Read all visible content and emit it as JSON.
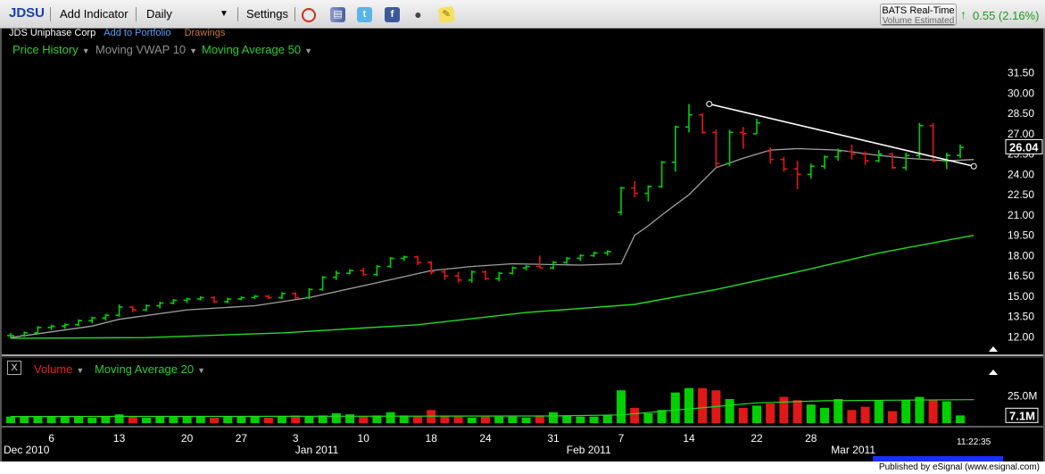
{
  "toolbar": {
    "symbol": "JDSU",
    "add_indicator": "Add Indicator",
    "interval": "Daily",
    "settings": "Settings",
    "icons": [
      "alarm-icon",
      "book-icon",
      "twitter-icon",
      "facebook-icon",
      "camera-icon",
      "note-icon"
    ],
    "twitter_glyph": "t",
    "facebook_glyph": "f",
    "camera_glyph": "●",
    "note_glyph": "✎",
    "alarm_glyph": "⏰",
    "book_glyph": "▤",
    "dropdown_glyph": "▼"
  },
  "quote": {
    "feed": "BATS Real-Time",
    "volume_note": "Volume Estimated",
    "arrow": "↑",
    "change": "0.55 (2.16%)"
  },
  "subheader": {
    "company": "JDS Uniphase Corp",
    "add_portfolio": "Add to Portfolio",
    "drawings": "Drawings"
  },
  "studies": {
    "price_history": "Price History",
    "vwap": "Moving VWAP 10",
    "ma50": "Moving Average 50",
    "dd": "▼"
  },
  "volume_panel": {
    "close_glyph": "X",
    "volume": "Volume",
    "ma20": "Moving Average 20",
    "dd": "▼"
  },
  "time_label": "11:22:35",
  "footer": "Published by eSignal (www.esignal.com)",
  "colors": {
    "up": "#00d000",
    "down": "#e01818",
    "vwap": "#a0a0a0",
    "ma": "#22dd22",
    "trendline": "#ffffff",
    "toolbar_bg": "#dddddd"
  },
  "chart_data": {
    "type": "ohlc",
    "ylim": [
      11.5,
      32.0
    ],
    "y_ticks": [
      12.0,
      13.5,
      15.0,
      16.5,
      18.0,
      19.5,
      21.0,
      22.5,
      24.0,
      25.5,
      27.0,
      28.5,
      30.0,
      31.5
    ],
    "y_tick_labels": [
      "12.00",
      "13.50",
      "15.00",
      "16.50",
      "18.00",
      "19.50",
      "21.00",
      "22.50",
      "24.00",
      "25.50",
      "27.00",
      "28.50",
      "30.00",
      "31.50"
    ],
    "last_price_label": "26.04",
    "last_price": 26.04,
    "x_ticks": [
      {
        "i": 3,
        "label": "6"
      },
      {
        "i": 8,
        "label": "13"
      },
      {
        "i": 13,
        "label": "20"
      },
      {
        "i": 17,
        "label": "27"
      },
      {
        "i": 21,
        "label": "3"
      },
      {
        "i": 26,
        "label": "10"
      },
      {
        "i": 31,
        "label": "18"
      },
      {
        "i": 35,
        "label": "24"
      },
      {
        "i": 40,
        "label": "31"
      },
      {
        "i": 45,
        "label": "7"
      },
      {
        "i": 50,
        "label": "14"
      },
      {
        "i": 55,
        "label": "22"
      },
      {
        "i": 59,
        "label": "28"
      }
    ],
    "month_labels": [
      {
        "i": -0.3,
        "label": "Dec 2010"
      },
      {
        "i": 21.5,
        "label": "Jan 2011"
      },
      {
        "i": 41.5,
        "label": "Feb 2011"
      },
      {
        "i": 61,
        "label": "Mar 2011"
      }
    ],
    "ohlc": [
      [
        12.1,
        12.3,
        11.9,
        12.1
      ],
      [
        12.1,
        12.4,
        12.0,
        12.3
      ],
      [
        12.3,
        12.8,
        12.2,
        12.7
      ],
      [
        12.7,
        12.9,
        12.5,
        12.8
      ],
      [
        12.8,
        13.0,
        12.6,
        12.9
      ],
      [
        12.9,
        13.3,
        12.8,
        13.2
      ],
      [
        13.2,
        13.5,
        13.0,
        13.4
      ],
      [
        13.4,
        13.7,
        13.2,
        13.6
      ],
      [
        13.6,
        14.4,
        13.5,
        14.2
      ],
      [
        14.2,
        14.3,
        13.8,
        14.0
      ],
      [
        14.0,
        14.4,
        13.9,
        14.3
      ],
      [
        14.3,
        14.6,
        14.1,
        14.5
      ],
      [
        14.5,
        14.8,
        14.4,
        14.7
      ],
      [
        14.7,
        14.9,
        14.5,
        14.8
      ],
      [
        14.8,
        15.0,
        14.7,
        14.9
      ],
      [
        14.9,
        15.0,
        14.5,
        14.6
      ],
      [
        14.6,
        14.9,
        14.5,
        14.8
      ],
      [
        14.8,
        15.0,
        14.7,
        14.9
      ],
      [
        14.9,
        15.1,
        14.8,
        15.0
      ],
      [
        15.0,
        15.1,
        14.8,
        14.9
      ],
      [
        14.9,
        15.3,
        14.8,
        15.2
      ],
      [
        15.2,
        15.3,
        14.8,
        14.9
      ],
      [
        14.9,
        15.6,
        14.8,
        15.5
      ],
      [
        15.5,
        16.5,
        15.4,
        16.4
      ],
      [
        16.4,
        16.9,
        16.2,
        16.7
      ],
      [
        16.7,
        17.0,
        16.6,
        16.9
      ],
      [
        16.9,
        17.1,
        16.5,
        16.6
      ],
      [
        16.6,
        17.3,
        16.5,
        17.2
      ],
      [
        17.2,
        17.9,
        17.1,
        17.8
      ],
      [
        17.8,
        18.0,
        17.6,
        17.9
      ],
      [
        17.9,
        18.0,
        17.3,
        17.5
      ],
      [
        17.5,
        17.6,
        16.6,
        16.8
      ],
      [
        16.8,
        17.0,
        16.2,
        16.5
      ],
      [
        16.5,
        16.8,
        16.0,
        16.2
      ],
      [
        16.2,
        16.9,
        16.0,
        16.8
      ],
      [
        16.8,
        16.9,
        16.2,
        16.3
      ],
      [
        16.3,
        16.8,
        16.1,
        16.7
      ],
      [
        16.7,
        17.2,
        16.6,
        17.1
      ],
      [
        17.1,
        17.3,
        16.9,
        17.2
      ],
      [
        17.2,
        18.0,
        17.1,
        17.1
      ],
      [
        17.1,
        17.6,
        17.0,
        17.5
      ],
      [
        17.5,
        17.9,
        17.4,
        17.8
      ],
      [
        17.8,
        18.1,
        17.6,
        18.0
      ],
      [
        18.0,
        18.3,
        17.9,
        18.2
      ],
      [
        18.2,
        18.4,
        18.0,
        18.3
      ],
      [
        21.2,
        23.1,
        21.0,
        23.0
      ],
      [
        23.0,
        23.5,
        22.3,
        22.6
      ],
      [
        22.6,
        23.2,
        22.0,
        23.1
      ],
      [
        23.1,
        25.0,
        23.0,
        24.9
      ],
      [
        24.9,
        27.6,
        24.2,
        27.5
      ],
      [
        27.5,
        29.2,
        27.1,
        28.4
      ],
      [
        28.4,
        28.5,
        27.0,
        27.1
      ],
      [
        27.1,
        27.3,
        24.5,
        24.8
      ],
      [
        24.8,
        27.3,
        24.6,
        27.1
      ],
      [
        27.1,
        27.5,
        25.9,
        27.0
      ],
      [
        27.0,
        28.1,
        27.0,
        27.8
      ],
      [
        25.7,
        26.0,
        24.8,
        25.1
      ],
      [
        25.1,
        25.3,
        24.2,
        24.4
      ],
      [
        24.4,
        25.0,
        22.9,
        24.0
      ],
      [
        24.0,
        24.8,
        23.7,
        24.6
      ],
      [
        24.6,
        25.4,
        24.4,
        25.3
      ],
      [
        25.3,
        25.9,
        25.0,
        25.7
      ],
      [
        25.7,
        26.2,
        25.1,
        25.5
      ],
      [
        25.5,
        25.7,
        24.7,
        25.0
      ],
      [
        25.0,
        25.8,
        24.9,
        25.5
      ],
      [
        25.5,
        25.6,
        24.4,
        24.5
      ],
      [
        24.5,
        25.6,
        24.3,
        25.4
      ],
      [
        25.4,
        27.8,
        25.2,
        27.6
      ],
      [
        27.6,
        27.8,
        24.9,
        25.0
      ],
      [
        25.0,
        25.6,
        24.4,
        25.4
      ],
      [
        25.4,
        26.2,
        25.2,
        26.0
      ]
    ],
    "vwap10": [
      {
        "i": 0,
        "v": 11.95
      },
      {
        "i": 6,
        "v": 12.8
      },
      {
        "i": 8,
        "v": 13.3
      },
      {
        "i": 13,
        "v": 14.0
      },
      {
        "i": 18,
        "v": 14.3
      },
      {
        "i": 22,
        "v": 14.9
      },
      {
        "i": 27,
        "v": 16.0
      },
      {
        "i": 31,
        "v": 16.9
      },
      {
        "i": 34,
        "v": 17.2
      },
      {
        "i": 37,
        "v": 17.4
      },
      {
        "i": 42,
        "v": 17.3
      },
      {
        "i": 45,
        "v": 17.4
      },
      {
        "i": 46,
        "v": 19.5
      },
      {
        "i": 47,
        "v": 20.2
      },
      {
        "i": 48,
        "v": 21.0
      },
      {
        "i": 50,
        "v": 22.5
      },
      {
        "i": 52,
        "v": 24.5
      },
      {
        "i": 54,
        "v": 25.2
      },
      {
        "i": 56,
        "v": 25.8
      },
      {
        "i": 58,
        "v": 25.9
      },
      {
        "i": 61,
        "v": 25.8
      },
      {
        "i": 64,
        "v": 25.4
      },
      {
        "i": 66,
        "v": 25.2
      },
      {
        "i": 69,
        "v": 25.0
      },
      {
        "i": 71,
        "v": 25.1
      }
    ],
    "ma50": [
      {
        "i": 0,
        "v": 11.9
      },
      {
        "i": 10,
        "v": 11.95
      },
      {
        "i": 20,
        "v": 12.3
      },
      {
        "i": 30,
        "v": 12.9
      },
      {
        "i": 38,
        "v": 13.8
      },
      {
        "i": 46,
        "v": 14.4
      },
      {
        "i": 52,
        "v": 15.5
      },
      {
        "i": 58,
        "v": 16.8
      },
      {
        "i": 64,
        "v": 18.2
      },
      {
        "i": 71,
        "v": 19.5
      }
    ],
    "trendline": [
      {
        "i": 51.5,
        "v": 29.2
      },
      {
        "i": 71,
        "v": 24.6
      }
    ],
    "volume": {
      "ylim": [
        0,
        40
      ],
      "tick_labels": [
        "25.0M"
      ],
      "ticks": [
        25
      ],
      "last_label": "7.1M",
      "last": 7.1,
      "values": [
        6,
        6,
        6,
        6,
        6,
        6,
        5,
        6,
        8,
        6,
        5,
        6,
        6,
        6,
        6,
        5,
        6,
        6,
        6,
        5,
        6,
        7,
        6,
        7,
        9,
        8,
        6,
        7,
        10,
        7,
        6,
        12,
        7,
        6,
        5,
        6,
        6,
        6,
        5,
        7,
        10,
        7,
        6,
        6,
        7,
        30,
        14,
        9,
        12,
        28,
        32,
        32,
        30,
        22,
        14,
        16,
        18,
        24,
        21,
        17,
        14,
        22,
        12,
        15,
        21,
        11,
        21,
        24,
        21,
        20,
        7
      ]
    },
    "volume_ma20": [
      {
        "i": 0,
        "v": 6.0
      },
      {
        "i": 20,
        "v": 6.2
      },
      {
        "i": 40,
        "v": 6.5
      },
      {
        "i": 45,
        "v": 7.5
      },
      {
        "i": 50,
        "v": 13.0
      },
      {
        "i": 55,
        "v": 18.5
      },
      {
        "i": 60,
        "v": 20.5
      },
      {
        "i": 65,
        "v": 21.0
      },
      {
        "i": 71,
        "v": 21.5
      }
    ]
  }
}
